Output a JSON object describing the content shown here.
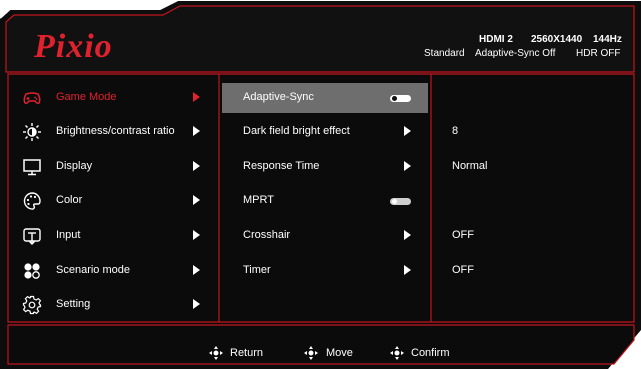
{
  "brand": {
    "logo_text": "Pixio",
    "accent_color": "#e0222f"
  },
  "status": {
    "input": "HDMI 2",
    "resolution": "2560X1440",
    "refresh": "144Hz",
    "mode": "Standard",
    "adaptive_sync": "Adaptive-Sync Off",
    "hdr": "HDR OFF"
  },
  "main_menu": [
    {
      "label": "Game Mode",
      "icon": "gamepad-icon",
      "active": true
    },
    {
      "label": "Brightness/contrast ratio",
      "icon": "brightness-icon",
      "active": false
    },
    {
      "label": "Display",
      "icon": "monitor-icon",
      "active": false
    },
    {
      "label": "Color",
      "icon": "palette-icon",
      "active": false
    },
    {
      "label": "Input",
      "icon": "input-icon",
      "active": false
    },
    {
      "label": "Scenario mode",
      "icon": "scenario-icon",
      "active": false
    },
    {
      "label": "Setting",
      "icon": "gear-icon",
      "active": false
    }
  ],
  "sub_menu": [
    {
      "label": "Adaptive-Sync",
      "control": "toggle",
      "toggle_state": "off",
      "selected": true,
      "value": ""
    },
    {
      "label": "Dark field bright effect",
      "control": "arrow",
      "value": "8"
    },
    {
      "label": "Response Time",
      "control": "arrow",
      "value": "Normal"
    },
    {
      "label": "MPRT",
      "control": "toggle",
      "toggle_state": "off",
      "value": ""
    },
    {
      "label": "Crosshair",
      "control": "arrow",
      "value": "OFF"
    },
    {
      "label": "Timer",
      "control": "arrow",
      "value": "OFF"
    }
  ],
  "footer": {
    "return_label": "Return",
    "move_label": "Move",
    "confirm_label": "Confirm"
  }
}
